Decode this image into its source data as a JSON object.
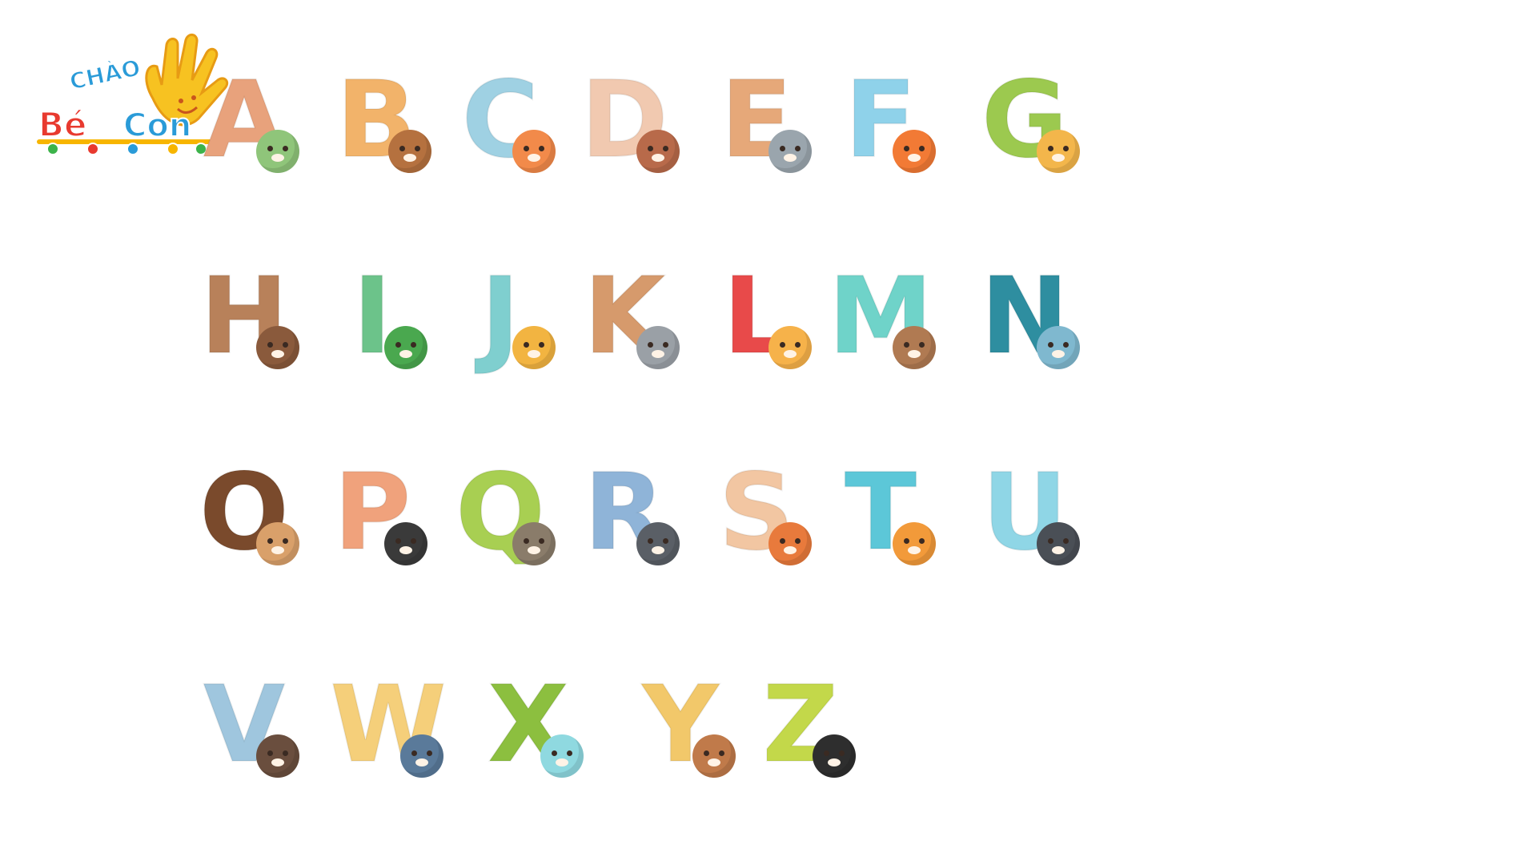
{
  "logo": {
    "line1": "CHÀO",
    "line2": "Bé",
    "line3": "Con",
    "colors": [
      "#e83a2f",
      "#2a9bd8",
      "#f7b500",
      "#3cb34a"
    ]
  },
  "letters": [
    {
      "letter": "A",
      "animal": "crocodile-icon",
      "letter_color": "#e8a27c",
      "animal_color": "#8fc57a"
    },
    {
      "letter": "B",
      "animal": "bear-icon",
      "letter_color": "#f2b36a",
      "animal_color": "#b5713f"
    },
    {
      "letter": "C",
      "animal": "cat-icon",
      "letter_color": "#9fd1e3",
      "animal_color": "#f28a4a"
    },
    {
      "letter": "D",
      "animal": "dog-icon",
      "letter_color": "#f1c9b0",
      "animal_color": "#b86a4a"
    },
    {
      "letter": "E",
      "animal": "elephant-icon",
      "letter_color": "#e6a879",
      "animal_color": "#9aa5ad"
    },
    {
      "letter": "F",
      "animal": "fox-icon",
      "letter_color": "#8fd2ea",
      "animal_color": "#f27a35"
    },
    {
      "letter": "G",
      "animal": "giraffe-icon",
      "letter_color": "#9cc94f",
      "animal_color": "#f3b64b"
    },
    {
      "letter": "H",
      "animal": "horse-icon",
      "letter_color": "#b8815a",
      "animal_color": "#8a5a3c"
    },
    {
      "letter": "I",
      "animal": "iguana-icon",
      "letter_color": "#6cc38a",
      "animal_color": "#4aa84f"
    },
    {
      "letter": "J",
      "animal": "jaguar-icon",
      "letter_color": "#7fcfcf",
      "animal_color": "#f2b441"
    },
    {
      "letter": "K",
      "animal": "koala-icon",
      "letter_color": "#d69a6c",
      "animal_color": "#9aa0a6"
    },
    {
      "letter": "L",
      "animal": "lion-icon",
      "letter_color": "#e84a4a",
      "animal_color": "#f6b24a"
    },
    {
      "letter": "M",
      "animal": "monkey-icon",
      "letter_color": "#6fd3c9",
      "animal_color": "#b07a52"
    },
    {
      "letter": "N",
      "animal": "narwhal-icon",
      "letter_color": "#2e8ea0",
      "animal_color": "#7fb8cf"
    },
    {
      "letter": "O",
      "animal": "owl-icon",
      "letter_color": "#7a4a2c",
      "animal_color": "#d9a06a"
    },
    {
      "letter": "P",
      "animal": "panda-icon",
      "letter_color": "#f0a27c",
      "animal_color": "#3a3a3a"
    },
    {
      "letter": "Q",
      "animal": "quail-icon",
      "letter_color": "#a8cf52",
      "animal_color": "#8a7c6a"
    },
    {
      "letter": "R",
      "animal": "raccoon-icon",
      "letter_color": "#8fb4d8",
      "animal_color": "#5a5f66"
    },
    {
      "letter": "S",
      "animal": "squirrel-icon",
      "letter_color": "#f2c6a2",
      "animal_color": "#e87a3c"
    },
    {
      "letter": "T",
      "animal": "tiger-icon",
      "letter_color": "#5cc7d8",
      "animal_color": "#f29a3a"
    },
    {
      "letter": "U",
      "animal": "hedgehog-icon",
      "letter_color": "#8fd6e6",
      "animal_color": "#4a4f56"
    },
    {
      "letter": "V",
      "animal": "bat-icon",
      "letter_color": "#9fc6de",
      "animal_color": "#6a4e3e"
    },
    {
      "letter": "W",
      "animal": "whale-icon",
      "letter_color": "#f5cf7a",
      "animal_color": "#5a7a9a"
    },
    {
      "letter": "X",
      "animal": "fish-icon",
      "letter_color": "#8cbf3f",
      "animal_color": "#8fd9e0"
    },
    {
      "letter": "Y",
      "animal": "yak-icon",
      "letter_color": "#f2c86a",
      "animal_color": "#c07a4a"
    },
    {
      "letter": "Z",
      "animal": "zebra-icon",
      "letter_color": "#c3d84a",
      "animal_color": "#2e2e2e"
    }
  ]
}
